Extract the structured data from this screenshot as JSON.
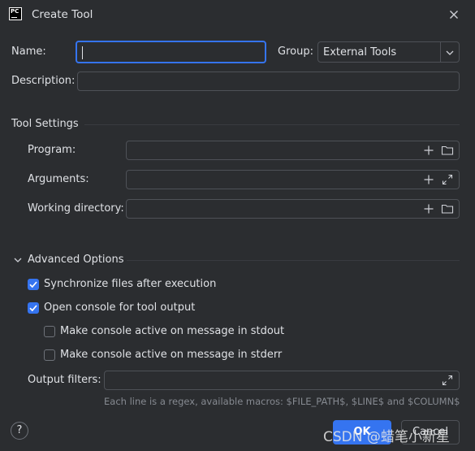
{
  "window": {
    "title": "Create Tool",
    "logo_text": "PC"
  },
  "form": {
    "name_label": "Name:",
    "name_value": "",
    "group_label": "Group:",
    "group_value": "External Tools",
    "description_label": "Description:",
    "description_value": ""
  },
  "tool_settings": {
    "heading": "Tool Settings",
    "program_label": "Program:",
    "program_value": "",
    "arguments_label": "Arguments:",
    "arguments_value": "",
    "working_dir_label": "Working directory:",
    "working_dir_value": ""
  },
  "advanced": {
    "heading": "Advanced Options",
    "options": [
      {
        "label": "Synchronize files after execution",
        "checked": true
      },
      {
        "label": "Open console for tool output",
        "checked": true
      },
      {
        "label": "Make console active on message in stdout",
        "checked": false
      },
      {
        "label": "Make console active on message in stderr",
        "checked": false
      }
    ],
    "output_filters_label": "Output filters:",
    "output_filters_value": "",
    "hint": "Each line is a regex, available macros: $FILE_PATH$, $LINE$ and $COLUMN$"
  },
  "footer": {
    "help": "?",
    "ok": "OK",
    "cancel": "Cancel"
  },
  "watermark": "CSDN @蜡笔小新星",
  "colors": {
    "accent": "#3574f0",
    "background": "#2b2d30",
    "border": "#4e5157"
  }
}
